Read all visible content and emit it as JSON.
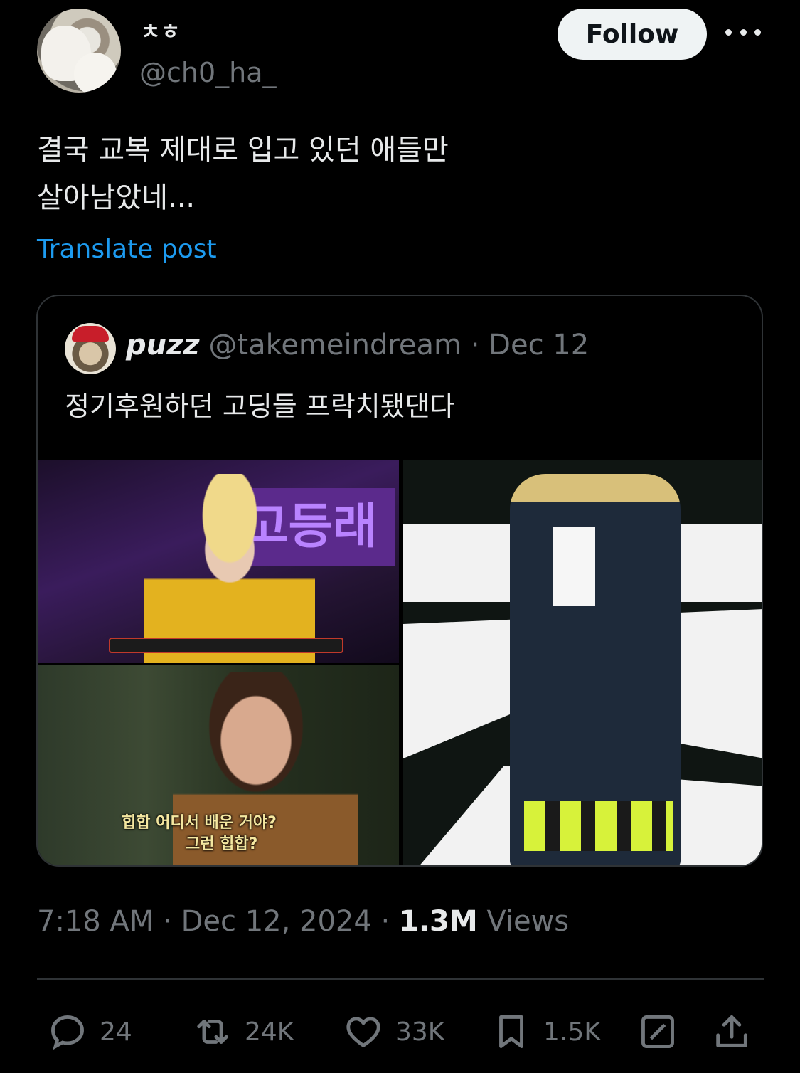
{
  "author": {
    "name": "ㅊㅎ",
    "handle": "@ch0_ha_"
  },
  "follow_label": "Follow",
  "post": {
    "text": "결국 교복 제대로 입고 있던 애들만\n살아남았네...",
    "translate_label": "Translate post"
  },
  "quote": {
    "name": "puzz",
    "handle": "@takemeindream",
    "separator": "·",
    "date": "Dec 12",
    "text": "정기후원하던 고딩들 프락치됐댄다",
    "image_a_sign": "고등래",
    "image_b_subtitle_1": "힙합 어디서 배운 거야?",
    "image_b_subtitle_2": "그런 힙합?"
  },
  "meta": {
    "time": "7:18 AM",
    "sep1": "·",
    "date": "Dec 12, 2024",
    "sep2": "·",
    "views_count": "1.3M",
    "views_label": "Views"
  },
  "actions": {
    "replies": "24",
    "reposts": "24K",
    "likes": "33K",
    "bookmarks": "1.5K"
  },
  "icons": {
    "more": "more-icon",
    "reply": "reply-icon",
    "repost": "repost-icon",
    "like": "heart-icon",
    "bookmark": "bookmark-icon",
    "grok": "grok-icon",
    "share": "share-icon"
  },
  "colors": {
    "background": "#000000",
    "text": "#e7e9ea",
    "muted": "#71767b",
    "link": "#1d9bf0",
    "border": "#2f3336",
    "follow_bg": "#eff3f4"
  }
}
